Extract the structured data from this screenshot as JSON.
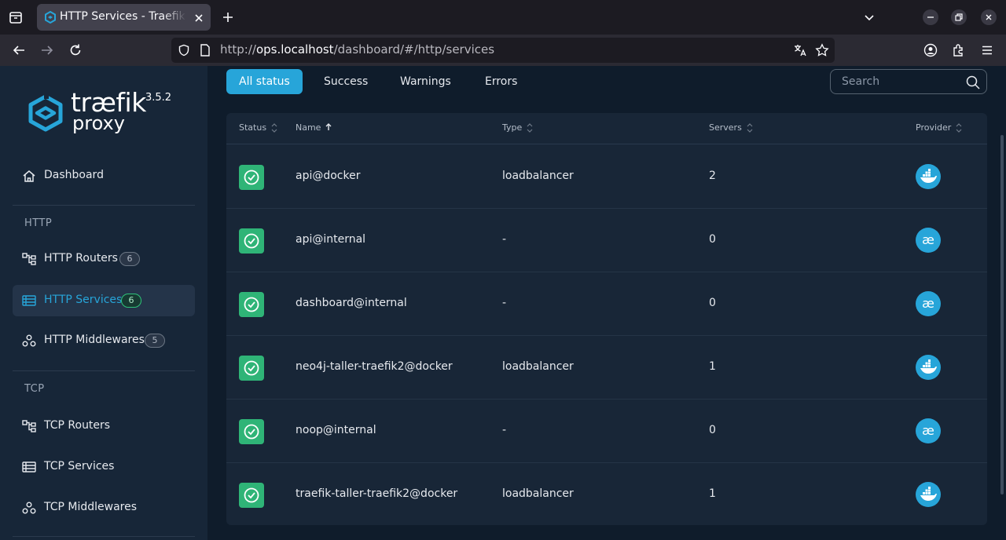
{
  "browser": {
    "tab_title": "HTTP Services - Traefik Proxy",
    "url_prefix": "http://",
    "url_host": "ops.localhost",
    "url_path": "/dashboard/#/http/services"
  },
  "sidebar": {
    "logo_word": "træfik",
    "logo_sub": "proxy",
    "version": "3.5.2",
    "dashboard_label": "Dashboard",
    "http_heading": "HTTP",
    "tcp_heading": "TCP",
    "items": [
      {
        "label": "HTTP Routers",
        "badge": "6"
      },
      {
        "label": "HTTP Services",
        "badge": "6"
      },
      {
        "label": "HTTP Middlewares",
        "badge": "5"
      },
      {
        "label": "TCP Routers"
      },
      {
        "label": "TCP Services"
      },
      {
        "label": "TCP Middlewares"
      }
    ]
  },
  "filters": [
    "All status",
    "Success",
    "Warnings",
    "Errors"
  ],
  "search": {
    "placeholder": "Search"
  },
  "table": {
    "headers": [
      "Status",
      "Name",
      "Type",
      "Servers",
      "Provider"
    ],
    "rows": [
      {
        "name": "api@docker",
        "type": "loadbalancer",
        "servers": "2",
        "provider": "docker"
      },
      {
        "name": "api@internal",
        "type": "-",
        "servers": "0",
        "provider": "internal"
      },
      {
        "name": "dashboard@internal",
        "type": "-",
        "servers": "0",
        "provider": "internal"
      },
      {
        "name": "neo4j-taller-traefik2@docker",
        "type": "loadbalancer",
        "servers": "1",
        "provider": "docker"
      },
      {
        "name": "noop@internal",
        "type": "-",
        "servers": "0",
        "provider": "internal"
      },
      {
        "name": "traefik-taller-traefik2@docker",
        "type": "loadbalancer",
        "servers": "1",
        "provider": "docker"
      }
    ]
  },
  "colors": {
    "accent": "#27a5d9",
    "success": "#2fb477",
    "sidebar_bg": "#172638",
    "main_bg": "#0f1c2b"
  }
}
